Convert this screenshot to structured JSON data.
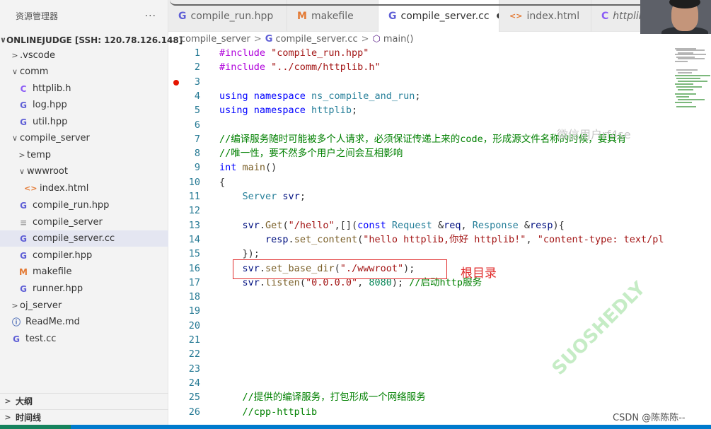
{
  "explorer": {
    "title": "资源管理器",
    "more": "···",
    "items": [
      {
        "label": "ONLINEJUDGE [SSH: 120.78.126.148]",
        "indent": 0,
        "chev": "∨",
        "icon": "",
        "root": true
      },
      {
        "label": ".vscode",
        "indent": 1,
        "chev": ">",
        "icon": ""
      },
      {
        "label": "comm",
        "indent": 1,
        "chev": "∨",
        "icon": ""
      },
      {
        "label": "httplib.h",
        "indent": 2,
        "chev": "",
        "icon": "C",
        "cls": "ic-c"
      },
      {
        "label": "log.hpp",
        "indent": 2,
        "chev": "",
        "icon": "G",
        "cls": "ic-cpp"
      },
      {
        "label": "util.hpp",
        "indent": 2,
        "chev": "",
        "icon": "G",
        "cls": "ic-cpp"
      },
      {
        "label": "compile_server",
        "indent": 1,
        "chev": "∨",
        "icon": ""
      },
      {
        "label": "temp",
        "indent": 2,
        "chev": ">",
        "icon": ""
      },
      {
        "label": "wwwroot",
        "indent": 2,
        "chev": "∨",
        "icon": ""
      },
      {
        "label": "index.html",
        "indent": 3,
        "chev": "",
        "icon": "<>",
        "cls": "ic-html"
      },
      {
        "label": "compile_run.hpp",
        "indent": 2,
        "chev": "",
        "icon": "G",
        "cls": "ic-cpp"
      },
      {
        "label": "compile_server",
        "indent": 2,
        "chev": "",
        "icon": "≡",
        "cls": "ic-txt"
      },
      {
        "label": "compile_server.cc",
        "indent": 2,
        "chev": "",
        "icon": "G",
        "cls": "ic-cpp",
        "active": true
      },
      {
        "label": "compiler.hpp",
        "indent": 2,
        "chev": "",
        "icon": "G",
        "cls": "ic-cpp"
      },
      {
        "label": "makefile",
        "indent": 2,
        "chev": "",
        "icon": "M",
        "cls": "ic-m"
      },
      {
        "label": "runner.hpp",
        "indent": 2,
        "chev": "",
        "icon": "G",
        "cls": "ic-cpp"
      },
      {
        "label": "oj_server",
        "indent": 1,
        "chev": ">",
        "icon": ""
      },
      {
        "label": "ReadMe.md",
        "indent": 1,
        "chev": "",
        "icon": "ⓘ",
        "cls": "ic-info"
      },
      {
        "label": "test.cc",
        "indent": 1,
        "chev": "",
        "icon": "G",
        "cls": "ic-cpp"
      }
    ],
    "outline": "大纲",
    "timeline": "时间线"
  },
  "tabs": [
    {
      "label": "compile_run.hpp",
      "icon": "G",
      "cls": "ic-cpp"
    },
    {
      "label": "makefile",
      "icon": "M",
      "cls": "ic-m"
    },
    {
      "label": "compile_server.cc",
      "icon": "G",
      "cls": "ic-cpp",
      "active": true,
      "dirty": "●"
    },
    {
      "label": "index.html",
      "icon": "<>",
      "cls": "ic-html"
    },
    {
      "label": "httplib",
      "icon": "C",
      "cls": "ic-c"
    }
  ],
  "breadcrumb": {
    "folder": "compile_server",
    "file": "compile_server.cc",
    "symbol": "main()",
    "sep": ">"
  },
  "code": [
    {
      "n": "1",
      "t": [
        [
          "kw-pp",
          "#include "
        ],
        [
          "str",
          "\"compile_run.hpp\""
        ]
      ]
    },
    {
      "n": "2",
      "t": [
        [
          "kw-pp",
          "#include "
        ],
        [
          "str",
          "\"../comm/httplib.h\""
        ]
      ]
    },
    {
      "n": "3",
      "t": []
    },
    {
      "n": "4",
      "t": [
        [
          "kw",
          "using namespace "
        ],
        [
          "ns",
          "ns_compile_and_run"
        ],
        [
          "",
          "; "
        ]
      ]
    },
    {
      "n": "5",
      "t": [
        [
          "kw",
          "using namespace "
        ],
        [
          "ns",
          "httplib"
        ],
        [
          "",
          ";"
        ]
      ]
    },
    {
      "n": "6",
      "t": []
    },
    {
      "n": "7",
      "t": [
        [
          "cm",
          "//编译服务随时可能被多个人请求，必须保证传递上来的code，形成源文件名称的时候，要具有"
        ]
      ]
    },
    {
      "n": "8",
      "t": [
        [
          "cm",
          "//唯一性，要不然多个用户之间会互相影响"
        ]
      ]
    },
    {
      "n": "9",
      "t": [
        [
          "kw",
          "int "
        ],
        [
          "fn",
          "main"
        ],
        [
          "",
          "()"
        ]
      ]
    },
    {
      "n": "10",
      "t": [
        [
          "",
          "{"
        ]
      ]
    },
    {
      "n": "11",
      "t": [
        [
          "",
          "    "
        ],
        [
          "typ",
          "Server "
        ],
        [
          "var",
          "svr"
        ],
        [
          "",
          ";"
        ]
      ]
    },
    {
      "n": "12",
      "t": []
    },
    {
      "n": "13",
      "t": [
        [
          "",
          "    "
        ],
        [
          "var",
          "svr"
        ],
        [
          "",
          "."
        ],
        [
          "fn",
          "Get"
        ],
        [
          "",
          "("
        ],
        [
          "str",
          "\"/hello\""
        ],
        [
          "",
          ",[]("
        ],
        [
          "kw",
          "const "
        ],
        [
          "typ",
          "Request "
        ],
        [
          "",
          "&"
        ],
        [
          "var",
          "req"
        ],
        [
          "",
          ", "
        ],
        [
          "typ",
          "Response "
        ],
        [
          "",
          "&"
        ],
        [
          "var",
          "resp"
        ],
        [
          "",
          "){"
        ]
      ]
    },
    {
      "n": "14",
      "t": [
        [
          "",
          "        "
        ],
        [
          "var",
          "resp"
        ],
        [
          "",
          "."
        ],
        [
          "fn",
          "set_content"
        ],
        [
          "",
          "("
        ],
        [
          "str",
          "\"hello httplib,你好 httplib!\""
        ],
        [
          "",
          ", "
        ],
        [
          "str",
          "\"content-type: text/pl"
        ]
      ]
    },
    {
      "n": "15",
      "t": [
        [
          "",
          "    });"
        ]
      ]
    },
    {
      "n": "16",
      "t": [
        [
          "",
          "    "
        ],
        [
          "var",
          "svr"
        ],
        [
          "",
          "."
        ],
        [
          "fn",
          "set_base_dir"
        ],
        [
          "",
          "("
        ],
        [
          "str",
          "\"./wwwroot\""
        ],
        [
          "",
          ");"
        ]
      ]
    },
    {
      "n": "17",
      "t": [
        [
          "",
          "    "
        ],
        [
          "var",
          "svr"
        ],
        [
          "",
          "."
        ],
        [
          "fn",
          "listen"
        ],
        [
          "",
          "("
        ],
        [
          "str",
          "\"0.0.0.0\""
        ],
        [
          "",
          ", "
        ],
        [
          "num",
          "8080"
        ],
        [
          "",
          "); "
        ],
        [
          "cm",
          "//启动http服务"
        ]
      ]
    },
    {
      "n": "18",
      "t": []
    },
    {
      "n": "19",
      "t": []
    },
    {
      "n": "20",
      "t": []
    },
    {
      "n": "21",
      "t": []
    },
    {
      "n": "22",
      "t": []
    },
    {
      "n": "23",
      "t": []
    },
    {
      "n": "24",
      "t": []
    },
    {
      "n": "25",
      "t": [
        [
          "",
          "    "
        ],
        [
          "cm",
          "//提供的编译服务，打包形成一个网络服务"
        ]
      ]
    },
    {
      "n": "26",
      "t": [
        [
          "",
          "    "
        ],
        [
          "cm",
          "//cpp-httplib"
        ]
      ]
    }
  ],
  "annotation": {
    "label": "根目录"
  },
  "watermark": {
    "top": "微信用户rf4se",
    "diag": "SUOSHEDLY"
  },
  "footer": {
    "csdn": "CSDN @陈陈陈--"
  }
}
